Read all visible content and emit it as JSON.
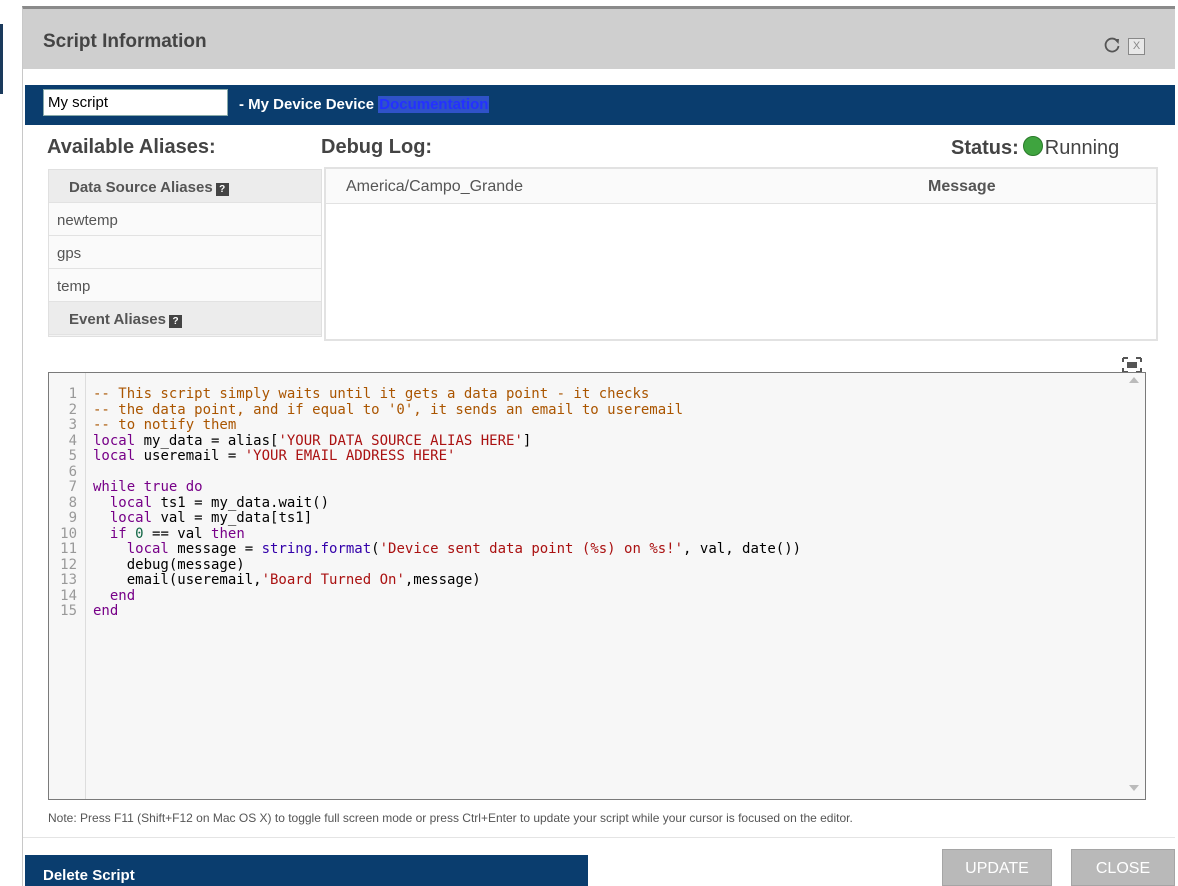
{
  "window": {
    "title": "Script Information"
  },
  "namebar": {
    "script_name": "My script",
    "device_label": " - My Device Device ",
    "doc_link": "Documentation"
  },
  "headings": {
    "aliases": "Available Aliases:",
    "debug": "Debug Log:",
    "status_label": "Status:",
    "status_value": "Running"
  },
  "aliases": {
    "data_source_header": "Data Source Aliases",
    "data_sources": [
      "newtemp",
      "gps",
      "temp"
    ],
    "event_header": "Event Aliases"
  },
  "debug_log": {
    "columns": [
      "America/Campo_Grande",
      "Message"
    ]
  },
  "editor": {
    "lines": [
      [
        {
          "t": "-- This script simply waits until it gets a data point - it checks",
          "c": "comment"
        }
      ],
      [
        {
          "t": "-- the data point, and if equal to '0', it sends an email to useremail",
          "c": "comment"
        }
      ],
      [
        {
          "t": "-- to notify them",
          "c": "comment"
        }
      ],
      [
        {
          "t": "local",
          "c": "keyword"
        },
        {
          "t": " my_data = alias[",
          "c": "var"
        },
        {
          "t": "'YOUR DATA SOURCE ALIAS HERE'",
          "c": "string"
        },
        {
          "t": "]",
          "c": "var"
        }
      ],
      [
        {
          "t": "local",
          "c": "keyword"
        },
        {
          "t": " useremail = ",
          "c": "var"
        },
        {
          "t": "'YOUR EMAIL ADDRESS HERE'",
          "c": "string"
        }
      ],
      [],
      [
        {
          "t": "while",
          "c": "keyword"
        },
        {
          "t": " ",
          "c": "var"
        },
        {
          "t": "true",
          "c": "keyword"
        },
        {
          "t": " ",
          "c": "var"
        },
        {
          "t": "do",
          "c": "keyword"
        }
      ],
      [
        {
          "t": "  ",
          "c": "var"
        },
        {
          "t": "local",
          "c": "keyword"
        },
        {
          "t": " ts1 = my_data.wait()",
          "c": "var"
        }
      ],
      [
        {
          "t": "  ",
          "c": "var"
        },
        {
          "t": "local",
          "c": "keyword"
        },
        {
          "t": " val = my_data[ts1]",
          "c": "var"
        }
      ],
      [
        {
          "t": "  ",
          "c": "var"
        },
        {
          "t": "if",
          "c": "keyword"
        },
        {
          "t": " ",
          "c": "var"
        },
        {
          "t": "0",
          "c": "number"
        },
        {
          "t": " == val ",
          "c": "var"
        },
        {
          "t": "then",
          "c": "keyword"
        }
      ],
      [
        {
          "t": "    ",
          "c": "var"
        },
        {
          "t": "local",
          "c": "keyword"
        },
        {
          "t": " message = ",
          "c": "var"
        },
        {
          "t": "string.format",
          "c": "builtin"
        },
        {
          "t": "(",
          "c": "var"
        },
        {
          "t": "'Device sent data point (%s) on %s!'",
          "c": "string"
        },
        {
          "t": ", val, date())",
          "c": "var"
        }
      ],
      [
        {
          "t": "    debug(message)",
          "c": "var"
        }
      ],
      [
        {
          "t": "    email(useremail,",
          "c": "var"
        },
        {
          "t": "'Board Turned On'",
          "c": "string"
        },
        {
          "t": ",message)",
          "c": "var"
        }
      ],
      [
        {
          "t": "  ",
          "c": "var"
        },
        {
          "t": "end",
          "c": "keyword"
        }
      ],
      [
        {
          "t": "end",
          "c": "keyword"
        }
      ]
    ]
  },
  "note": "Note: Press F11 (Shift+F12 on Mac OS X) to toggle full screen mode or press Ctrl+Enter to update your script while your cursor is focused on the editor.",
  "footer": {
    "delete_label": "Delete Script",
    "update_label": "UPDATE",
    "close_label": "CLOSE"
  },
  "colors": {
    "accent_navy": "#0a3d6e",
    "status_green": "#3fa43f",
    "button_gray": "#b9b9b9"
  }
}
